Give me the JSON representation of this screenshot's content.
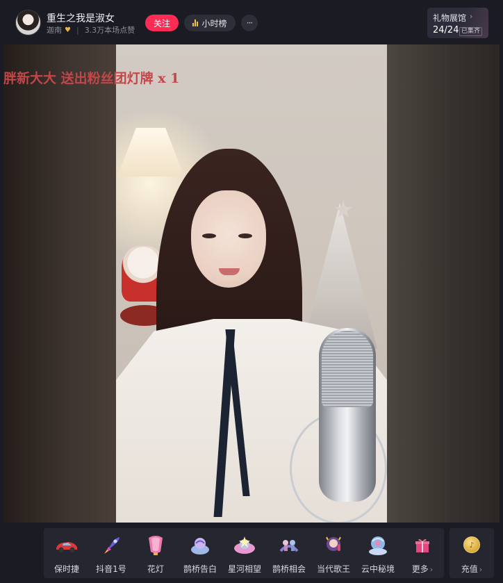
{
  "header": {
    "anchor_name": "重生之我是淑女",
    "anchor_handle": "迦南",
    "likes_text": "3.3万本场点赞",
    "follow_label": "关注",
    "rank_label": "小时榜",
    "more_label": "···"
  },
  "gift_hall": {
    "title": "礼物展馆",
    "progress": "24/24",
    "badge": "已集齐"
  },
  "banner": {
    "text": "胖新大大 送出粉丝团灯牌 x 1",
    "color": "#c2464a"
  },
  "gifts": [
    {
      "label": "保时捷",
      "icon": "sports-car-icon"
    },
    {
      "label": "抖音1号",
      "icon": "rocket-icon"
    },
    {
      "label": "花灯",
      "icon": "lantern-icon"
    },
    {
      "label": "鹊桥告白",
      "icon": "magpie-bridge-icon"
    },
    {
      "label": "星河相望",
      "icon": "galaxy-icon"
    },
    {
      "label": "鹊桥相会",
      "icon": "bridge-meeting-icon"
    },
    {
      "label": "当代歌王",
      "icon": "singer-icon"
    },
    {
      "label": "云中秘境",
      "icon": "cloud-realm-icon"
    },
    {
      "label": "更多",
      "icon": "gift-box-icon"
    }
  ],
  "recharge": {
    "label": "充值",
    "icon": "coin-icon"
  },
  "colors": {
    "accent": "#fe2c55",
    "background": "#1b1b24",
    "panel": "#262630"
  }
}
